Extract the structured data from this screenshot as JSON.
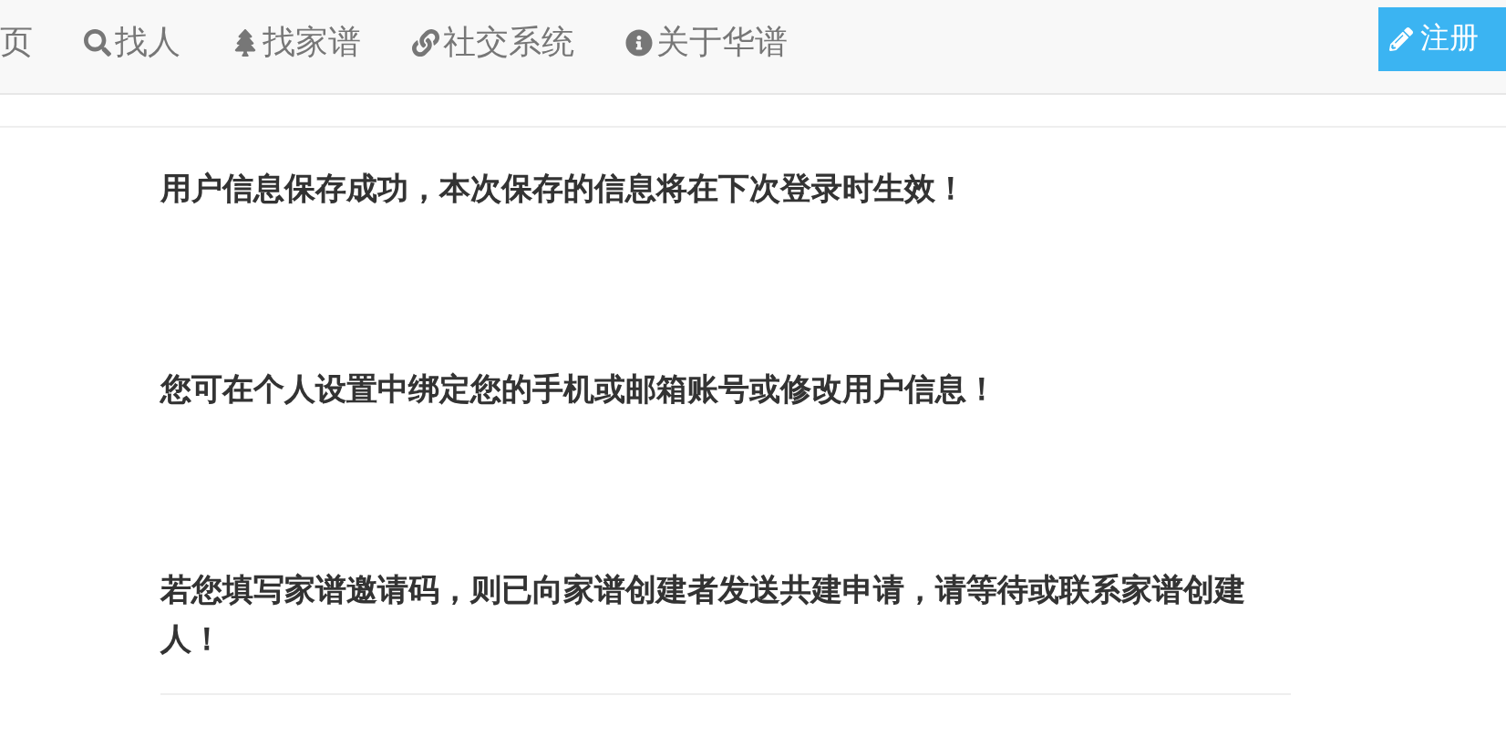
{
  "navbar": {
    "items": [
      {
        "label": "页"
      },
      {
        "label": "找人"
      },
      {
        "label": "找家谱"
      },
      {
        "label": "社交系统"
      },
      {
        "label": "关于华谱"
      }
    ],
    "register_button": "注册"
  },
  "messages": [
    "用户信息保存成功，本次保存的信息将在下次登录时生效！",
    "您可在个人设置中绑定您的手机或邮箱账号或修改用户信息！",
    "若您填写家谱邀请码，则已向家谱创建者发送共建申请，请等待或联系家谱创建人！"
  ]
}
